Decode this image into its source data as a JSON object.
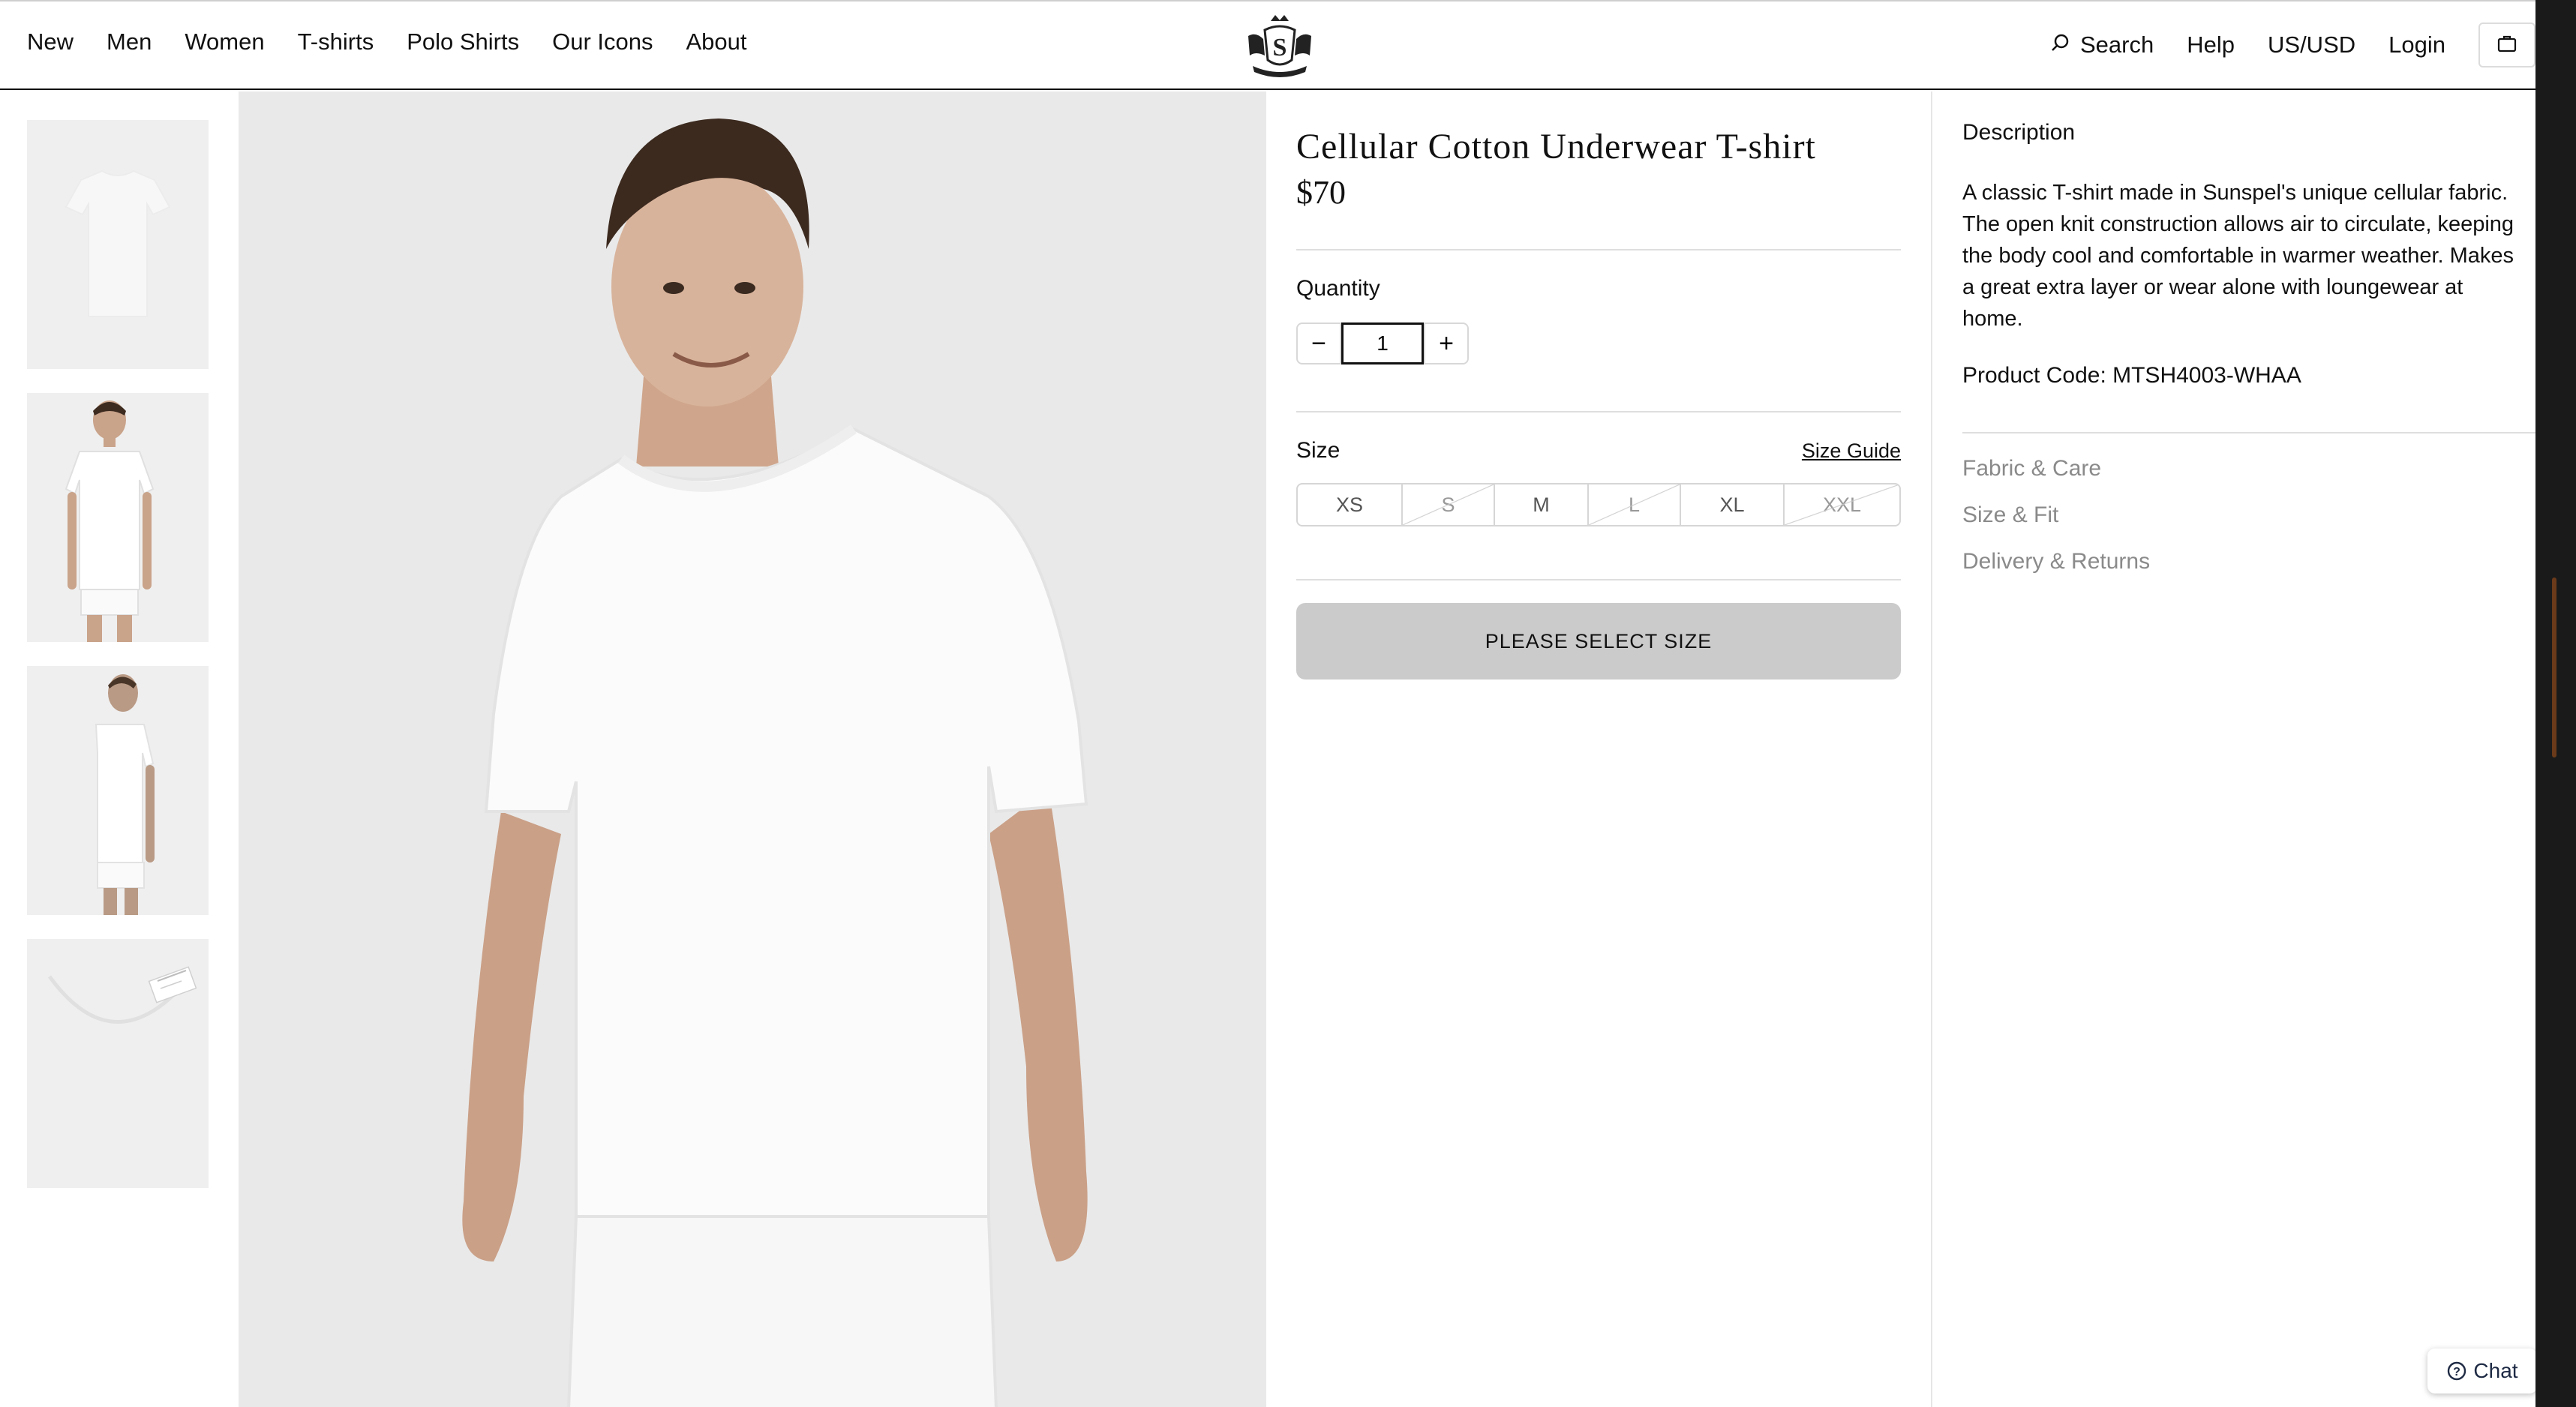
{
  "nav": {
    "items": [
      "New",
      "Men",
      "Women",
      "T-shirts",
      "Polo Shirts",
      "Our Icons",
      "About"
    ]
  },
  "logo": {
    "icon": "crest-logo-icon",
    "letter": "S"
  },
  "utility": {
    "search_label": "Search",
    "help_label": "Help",
    "currency_label": "US/USD",
    "login_label": "Login",
    "bag_icon": "bag-icon"
  },
  "gallery": {
    "thumbnails": [
      "t-shirt-flat",
      "model-front",
      "model-side",
      "collar-label"
    ]
  },
  "product": {
    "title": "Cellular Cotton Underwear T-shirt",
    "price": "$70",
    "quantity_label": "Quantity",
    "quantity_value": "1",
    "size_label": "Size",
    "size_guide_label": "Size Guide",
    "sizes": [
      {
        "label": "XS",
        "available": true
      },
      {
        "label": "S",
        "available": false
      },
      {
        "label": "M",
        "available": true
      },
      {
        "label": "L",
        "available": false
      },
      {
        "label": "XL",
        "available": true
      },
      {
        "label": "XXL",
        "available": false
      }
    ],
    "cta_label": "PLEASE SELECT SIZE",
    "cta_color": "#cbcbcb"
  },
  "description": {
    "heading": "Description",
    "body": "A classic T-shirt made in Sunspel's unique cellular fabric. The open knit construction allows air to circulate, keeping the body cool and comfortable in warmer weather. Makes a great extra layer or wear alone with loungewear at home.",
    "product_code": "Product Code: MTSH4003-WHAA",
    "accordion": [
      "Fabric & Care",
      "Size & Fit",
      "Delivery & Returns"
    ]
  },
  "chat": {
    "label": "Chat",
    "icon": "help-circle-icon"
  }
}
